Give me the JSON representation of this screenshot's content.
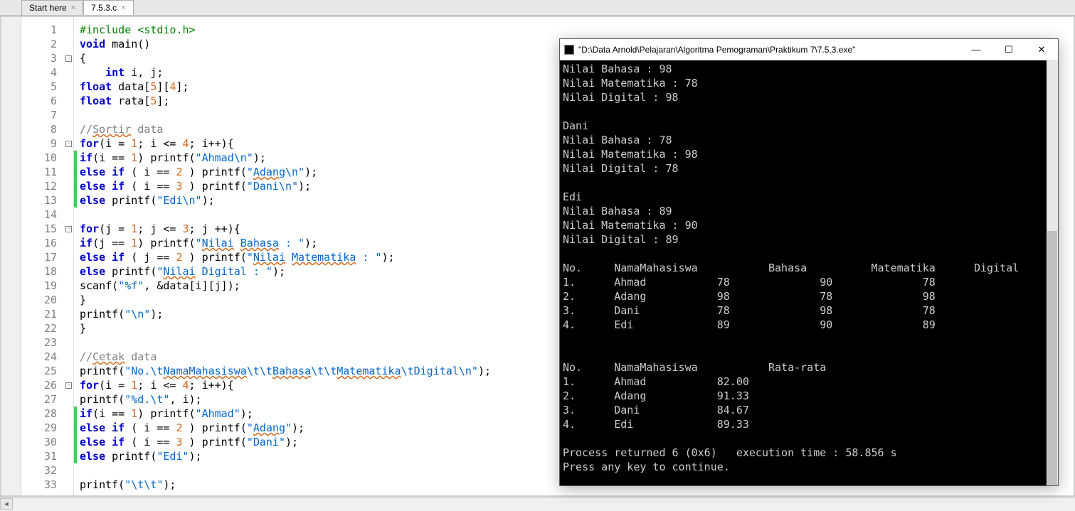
{
  "tabs": [
    {
      "label": "Start here",
      "active": false
    },
    {
      "label": "7.5.3.c",
      "active": true
    }
  ],
  "code": {
    "lines": [
      {
        "n": 1,
        "fold": "",
        "change": "",
        "html": "<span class='preproc'>#include</span> <span class='ang'>&lt;stdio.h&gt;</span>"
      },
      {
        "n": 2,
        "fold": "",
        "change": "",
        "html": "<span class='kw'>void</span> main()"
      },
      {
        "n": 3,
        "fold": "box",
        "change": "",
        "html": "{"
      },
      {
        "n": 4,
        "fold": "",
        "change": "",
        "html": "    <span class='kw'>int</span> i, j;"
      },
      {
        "n": 5,
        "fold": "",
        "change": "",
        "html": "<span class='kw'>float</span> data[<span class='num'>5</span>][<span class='num'>4</span>];"
      },
      {
        "n": 6,
        "fold": "",
        "change": "",
        "html": "<span class='kw'>float</span> rata[<span class='num'>5</span>];"
      },
      {
        "n": 7,
        "fold": "",
        "change": "",
        "html": ""
      },
      {
        "n": 8,
        "fold": "",
        "change": "",
        "html": "<span class='comment'>//<span class='squiggle'>Sortir</span> data</span>"
      },
      {
        "n": 9,
        "fold": "box",
        "change": "",
        "html": "<span class='kw'>for</span>(i = <span class='num'>1</span>; i &lt;= <span class='num'>4</span>; i++){"
      },
      {
        "n": 10,
        "fold": "",
        "change": "green",
        "html": "<span class='kw'>if</span>(i == <span class='num'>1</span>) printf(<span class='str'>\"Ahmad\\n\"</span>);"
      },
      {
        "n": 11,
        "fold": "",
        "change": "green",
        "html": "<span class='kw'>else</span> <span class='kw'>if</span> ( i == <span class='num'>2</span> ) printf(<span class='str'>\"<span class='squiggle'>Adang</span>\\n\"</span>);"
      },
      {
        "n": 12,
        "fold": "",
        "change": "green",
        "html": "<span class='kw'>else</span> <span class='kw'>if</span> ( i == <span class='num'>3</span> ) printf(<span class='str'>\"Dani\\n\"</span>);"
      },
      {
        "n": 13,
        "fold": "",
        "change": "green",
        "html": "<span class='kw'>else</span> printf(<span class='str'>\"Edi\\n\"</span>);"
      },
      {
        "n": 14,
        "fold": "",
        "change": "",
        "html": ""
      },
      {
        "n": 15,
        "fold": "box",
        "change": "",
        "html": "<span class='kw'>for</span>(j = <span class='num'>1</span>; j &lt;= <span class='num'>3</span>; j ++){"
      },
      {
        "n": 16,
        "fold": "",
        "change": "",
        "html": "<span class='kw'>if</span>(j == <span class='num'>1</span>) printf(<span class='str'>\"<span class='squiggle'>Nilai</span> <span class='squiggle'>Bahasa</span> : \"</span>);"
      },
      {
        "n": 17,
        "fold": "",
        "change": "",
        "html": "<span class='kw'>else</span> <span class='kw'>if</span> ( j == <span class='num'>2</span> ) printf(<span class='str'>\"<span class='squiggle'>Nilai</span> <span class='squiggle'>Matematika</span> : \"</span>);"
      },
      {
        "n": 18,
        "fold": "",
        "change": "",
        "html": "<span class='kw'>else</span> printf(<span class='str'>\"<span class='squiggle'>Nilai</span> Digital : \"</span>);"
      },
      {
        "n": 19,
        "fold": "",
        "change": "",
        "html": "scanf(<span class='str'>\"%f\"</span>, &amp;data[i][j]);"
      },
      {
        "n": 20,
        "fold": "",
        "change": "",
        "html": "}"
      },
      {
        "n": 21,
        "fold": "",
        "change": "",
        "html": "printf(<span class='str'>\"\\n\"</span>);"
      },
      {
        "n": 22,
        "fold": "",
        "change": "",
        "html": "}"
      },
      {
        "n": 23,
        "fold": "",
        "change": "",
        "html": ""
      },
      {
        "n": 24,
        "fold": "",
        "change": "",
        "html": "<span class='comment'>//<span class='squiggle'>Cetak</span> data</span>"
      },
      {
        "n": 25,
        "fold": "",
        "change": "",
        "html": "printf(<span class='str'>\"No.\\t<span class='squiggle'>NamaMahasiswa</span>\\t\\t<span class='squiggle'>Bahasa</span>\\t\\t<span class='squiggle'>Matematika</span>\\tDigital\\n\"</span>);"
      },
      {
        "n": 26,
        "fold": "box",
        "change": "",
        "html": "<span class='kw'>for</span>(i = <span class='num'>1</span>; i &lt;= <span class='num'>4</span>; i++){"
      },
      {
        "n": 27,
        "fold": "",
        "change": "",
        "html": "printf(<span class='str'>\"%d.\\t\"</span>, i);"
      },
      {
        "n": 28,
        "fold": "",
        "change": "green",
        "html": "<span class='kw'>if</span>(i == <span class='num'>1</span>) printf(<span class='str'>\"Ahmad\"</span>);"
      },
      {
        "n": 29,
        "fold": "",
        "change": "green",
        "html": "<span class='kw'>else</span> <span class='kw'>if</span> ( i == <span class='num'>2</span> ) printf(<span class='str'>\"<span class='squiggle'>Adang</span>\"</span>);"
      },
      {
        "n": 30,
        "fold": "",
        "change": "green",
        "html": "<span class='kw'>else</span> <span class='kw'>if</span> ( i == <span class='num'>3</span> ) printf(<span class='str'>\"Dani\"</span>);"
      },
      {
        "n": 31,
        "fold": "",
        "change": "green",
        "html": "<span class='kw'>else</span> printf(<span class='str'>\"Edi\"</span>);"
      },
      {
        "n": 32,
        "fold": "",
        "change": "",
        "html": ""
      },
      {
        "n": 33,
        "fold": "",
        "change": "",
        "html": "printf(<span class='str'>\"\\t\\t\"</span>);"
      }
    ]
  },
  "console": {
    "title": "\"D:\\Data Arnold\\Pelajaran\\Algoritma Pemograman\\Praktikum 7\\7.5.3.exe\"",
    "output": "Nilai Bahasa : 98\nNilai Matematika : 78\nNilai Digital : 98\n\nDani\nNilai Bahasa : 78\nNilai Matematika : 98\nNilai Digital : 78\n\nEdi\nNilai Bahasa : 89\nNilai Matematika : 90\nNilai Digital : 89\n\nNo.     NamaMahasiswa           Bahasa          Matematika      Digital\n1.      Ahmad           78              90              78\n2.      Adang           98              78              98\n3.      Dani            78              98              78\n4.      Edi             89              90              89\n\n\nNo.     NamaMahasiswa           Rata-rata\n1.      Ahmad           82.00\n2.      Adang           91.33\n3.      Dani            84.67\n4.      Edi             89.33\n\nProcess returned 6 (0x6)   execution time : 58.856 s\nPress any key to continue."
  },
  "titlebar_buttons": {
    "min": "—",
    "max": "☐",
    "close": "✕"
  }
}
